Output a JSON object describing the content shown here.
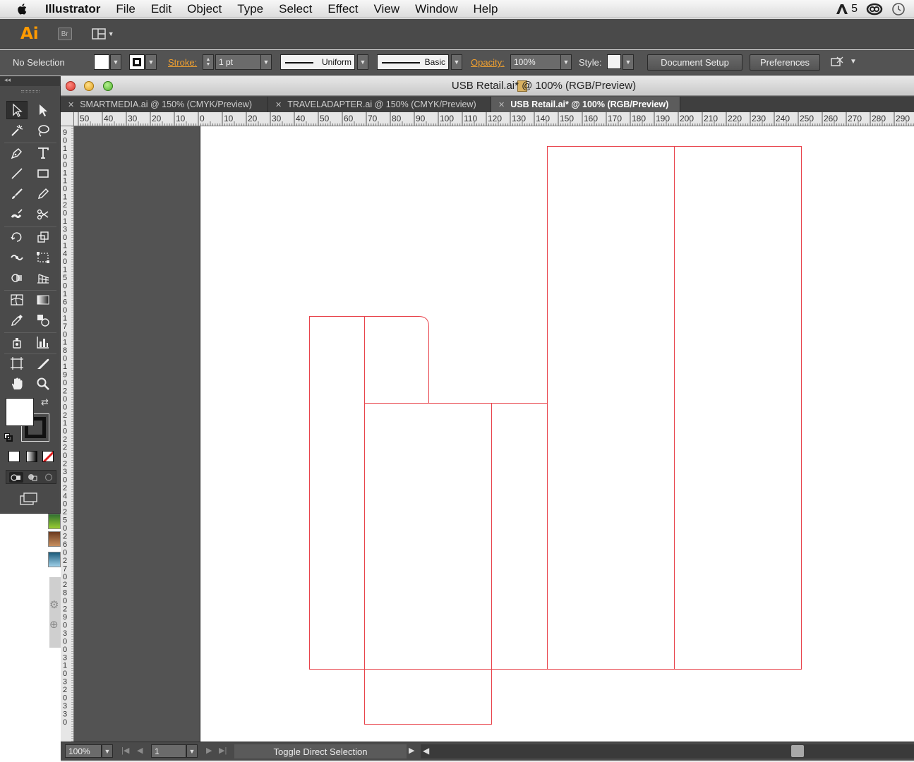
{
  "menubar": {
    "app_name": "Illustrator",
    "items": [
      "File",
      "Edit",
      "Object",
      "Type",
      "Select",
      "Effect",
      "View",
      "Window",
      "Help"
    ],
    "status_badge": "5"
  },
  "appbar": {
    "logo": "Ai",
    "bridge_label": "Br"
  },
  "controlbar": {
    "selection_label": "No Selection",
    "stroke_label": "Stroke:",
    "stroke_weight": "1 pt",
    "variable_width_profile": "Uniform",
    "brush_definition": "Basic",
    "opacity_label": "Opacity:",
    "opacity_value": "100%",
    "style_label": "Style:",
    "document_setup_label": "Document Setup",
    "preferences_label": "Preferences"
  },
  "document": {
    "window_title": "USB Retail.ai* @ 100% (RGB/Preview)",
    "tabs": [
      {
        "label": "SMARTMEDIA.ai @ 150% (CMYK/Preview)",
        "active": false
      },
      {
        "label": "TRAVELADAPTER.ai @ 150% (CMYK/Preview)",
        "active": false
      },
      {
        "label": "USB Retail.ai* @ 100% (RGB/Preview)",
        "active": true
      }
    ],
    "ruler_h_labels": [
      "50",
      "40",
      "30",
      "20",
      "10",
      "0",
      "10",
      "20",
      "30",
      "40",
      "50",
      "60",
      "70",
      "80",
      "90",
      "100",
      "110",
      "120",
      "130",
      "140",
      "150",
      "160",
      "170",
      "180",
      "190",
      "200",
      "210",
      "220",
      "230",
      "240",
      "250",
      "260",
      "270",
      "280",
      "290"
    ],
    "ruler_v_labels": [
      "9",
      "0",
      "1",
      "0",
      "0",
      "1",
      "1",
      "0",
      "1",
      "2",
      "0",
      "1",
      "3",
      "0",
      "1",
      "4",
      "0",
      "1",
      "5",
      "0",
      "1",
      "6",
      "0",
      "1",
      "7",
      "0",
      "1",
      "8",
      "0",
      "1",
      "9",
      "0",
      "2",
      "0",
      "0",
      "2",
      "1",
      "0",
      "2",
      "2",
      "0",
      "2",
      "3",
      "0",
      "2",
      "4",
      "0",
      "2",
      "5",
      "0",
      "2",
      "6",
      "0",
      "2",
      "7",
      "0",
      "2",
      "8",
      "0",
      "2",
      "9",
      "0",
      "3",
      "0",
      "0",
      "3",
      "1",
      "0",
      "3",
      "2",
      "0",
      "3",
      "3",
      "0"
    ],
    "guide_color": "#e8434b"
  },
  "statusbar": {
    "zoom": "100%",
    "artboard_number": "1",
    "status_text": "Toggle Direct Selection"
  },
  "colors": {
    "accent_orange": "#ff9a00",
    "panel_dark": "#4a4a4a",
    "control_bar": "#535353"
  }
}
